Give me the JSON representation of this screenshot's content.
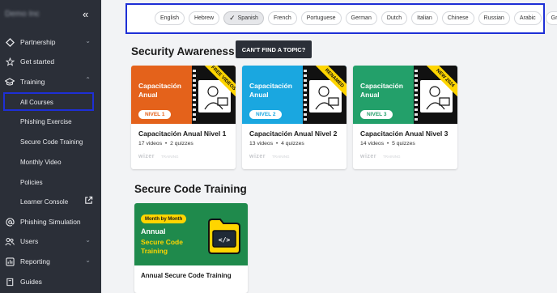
{
  "sidebar": {
    "org_name": "Demo Inc",
    "collapse_glyph": "«",
    "items": [
      {
        "label": "Partnership",
        "icon": "diamond-icon"
      },
      {
        "label": "Get started",
        "icon": "star-icon"
      },
      {
        "label": "Training",
        "icon": "graduation-cap-icon"
      },
      {
        "label": "Phishing Simulation",
        "icon": "at-sign-icon"
      },
      {
        "label": "Users",
        "icon": "users-icon"
      },
      {
        "label": "Reporting",
        "icon": "chart-icon"
      },
      {
        "label": "Guides",
        "icon": "book-icon"
      }
    ],
    "sub_items": [
      {
        "label": "All Courses"
      },
      {
        "label": "Phishing Exercise"
      },
      {
        "label": "Secure Code Training"
      },
      {
        "label": "Monthly Video"
      },
      {
        "label": "Policies"
      },
      {
        "label": "Learner Console"
      }
    ]
  },
  "languages": {
    "selected": "Spanish",
    "options": [
      "English",
      "Hebrew",
      "Spanish",
      "French",
      "Portuguese",
      "German",
      "Dutch",
      "Italian",
      "Chinese",
      "Russian",
      "Arabic",
      "Greek"
    ]
  },
  "sections": {
    "security_awareness": "Security Awareness",
    "cant_find": "CAN'T FIND A TOPIC?",
    "secure_code": "Secure Code Training"
  },
  "cards": [
    {
      "thumb_title": "Capacitación Anual",
      "nivel": "NIVEL 1",
      "ribbon": "FREE VIDEOS",
      "name": "Capacitación Anual Nivel 1",
      "videos": "17 videos",
      "quizzes": "2 quizzes",
      "brand": "wizer",
      "brand_sub": "TRAINING",
      "color": "#e4621b",
      "nivel_color": "#e4621b"
    },
    {
      "thumb_title": "Capacitación Anual",
      "nivel": "NIVEL 2",
      "ribbon": "RENAMED",
      "name": "Capacitación Anual Nivel 2",
      "videos": "13 videos",
      "quizzes": "4 quizzes",
      "brand": "wizer",
      "brand_sub": "TRAINING",
      "color": "#1aa7e0",
      "nivel_color": "#1aa7e0"
    },
    {
      "thumb_title": "Capacitación Anual",
      "nivel": "NIVEL 3",
      "ribbon": "NEW 2024",
      "name": "Capacitación Anual Nivel 3",
      "videos": "14 videos",
      "quizzes": "5 quizzes",
      "brand": "wizer",
      "brand_sub": "TRAINING",
      "color": "#23a06a",
      "nivel_color": "#23a06a"
    }
  ],
  "secure_code_card": {
    "badge": "Month by Month",
    "line1": "Annual",
    "line2": "Secure Code Training",
    "code_glyph": "</>",
    "name": "Annual Secure Code Training"
  },
  "meta_separator": "•"
}
